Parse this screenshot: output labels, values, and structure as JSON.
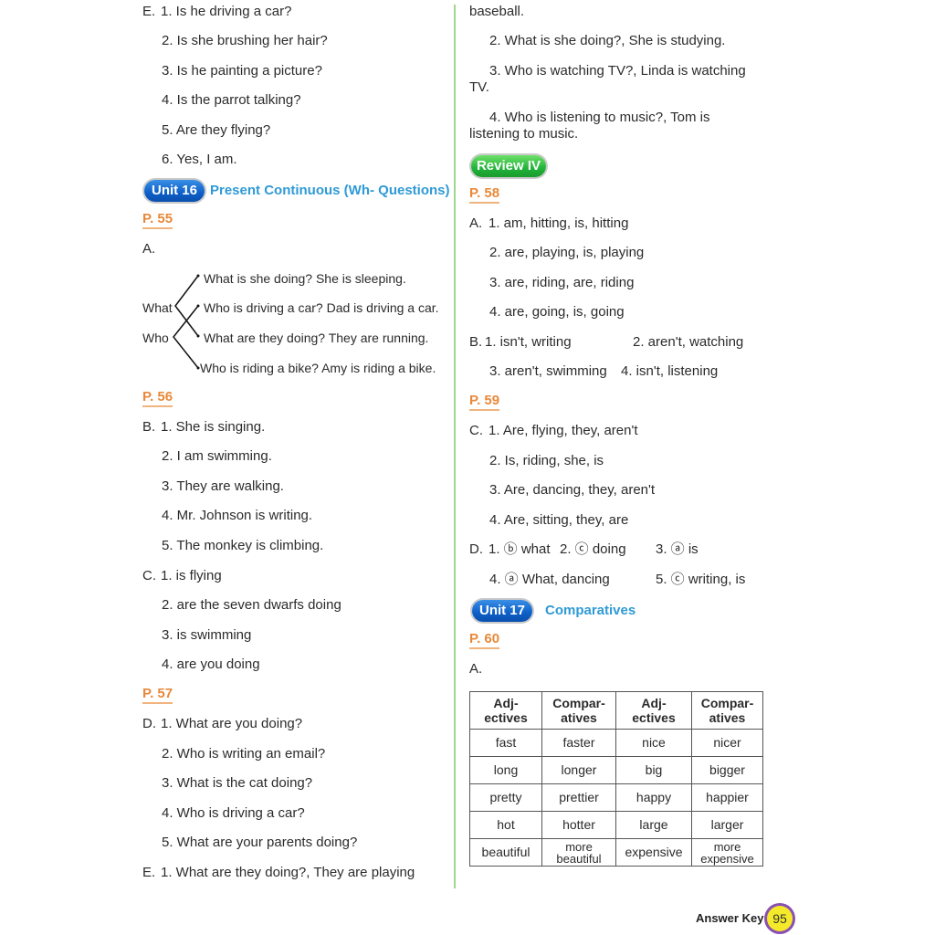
{
  "left": {
    "e_prev": {
      "label": "E.",
      "items": [
        "1. Is he driving a car?",
        "2. Is she brushing her hair?",
        "3. Is he painting a picture?",
        "4. Is the parrot talking?",
        "5. Are they flying?",
        "6. Yes, I am."
      ]
    },
    "unit16": {
      "badge": "Unit 16",
      "title": "Present Continuous (Wh- Questions)"
    },
    "p55": {
      "page": "P. 55",
      "label": "A.",
      "left_words": [
        "What",
        "Who"
      ],
      "right_sentences": [
        "What is she doing? She is sleeping.",
        "Who is driving a car? Dad is driving a car.",
        "What are they doing? They are running.",
        "Who is riding a bike? Amy is riding a bike."
      ]
    },
    "p56": {
      "page": "P. 56",
      "b": {
        "label": "B.",
        "items": [
          "1. She is singing.",
          "2. I am swimming.",
          "3. They are walking.",
          "4. Mr. Johnson is writing.",
          "5. The monkey is climbing."
        ]
      },
      "c": {
        "label": "C.",
        "items": [
          "1. is flying",
          "2. are the seven dwarfs doing",
          "3. is swimming",
          "4. are you doing"
        ]
      }
    },
    "p57": {
      "page": "P. 57",
      "d": {
        "label": "D.",
        "items": [
          "1. What are you doing?",
          "2. Who is writing an email?",
          "3. What is the cat doing?",
          "4. Who is driving a car?",
          "5. What are your parents doing?"
        ]
      },
      "e": {
        "label": "E.",
        "item1": "1. What are they doing?, They are playing"
      }
    }
  },
  "right": {
    "e_cont": {
      "item1_tail": "baseball.",
      "item2": "2. What is she doing?, She is studying.",
      "item3_a": "3. Who is watching TV?, Linda is watching",
      "item3_b": "TV.",
      "item4_a": "4. Who is listening to music?, Tom is",
      "item4_b": "listening to music."
    },
    "review": {
      "badge": "Review IV"
    },
    "p58": {
      "page": "P. 58",
      "a": {
        "label": "A.",
        "items": [
          "1. am, hitting, is, hitting",
          "2. are, playing, is, playing",
          "3. are, riding, are, riding",
          "4. are, going, is, going"
        ]
      },
      "b": {
        "label": "B.",
        "items": [
          "1. isn't, writing",
          "2. aren't, watching",
          "3. aren't, swimming",
          "4. isn't, listening"
        ]
      }
    },
    "p59": {
      "page": "P. 59",
      "c": {
        "label": "C.",
        "items": [
          "1. Are, flying, they, aren't",
          "2. Is, riding, she, is",
          "3. Are, dancing, they, aren't",
          "4. Are, sitting, they, are"
        ]
      },
      "d": {
        "label": "D.",
        "items": [
          "1. ⓑ what",
          "2. ⓒ doing",
          "3. ⓐ is",
          "4. ⓐ What, dancing",
          "5. ⓒ writing, is"
        ]
      }
    },
    "unit17": {
      "badge": "Unit 17",
      "title": "Comparatives"
    },
    "p60": {
      "page": "P. 60",
      "label": "A.",
      "table": {
        "headers": [
          [
            "Adj-",
            "ectives"
          ],
          [
            "Compar-",
            "atives"
          ],
          [
            "Adj-",
            "ectives"
          ],
          [
            "Compar-",
            "atives"
          ]
        ],
        "rows": [
          [
            "fast",
            "faster",
            "nice",
            "nicer"
          ],
          [
            "long",
            "longer",
            "big",
            "bigger"
          ],
          [
            "pretty",
            "prettier",
            "happy",
            "happier"
          ],
          [
            "hot",
            "hotter",
            "large",
            "larger"
          ],
          [
            "beautiful",
            "more beautiful",
            "expensive",
            "more expensive"
          ]
        ]
      }
    }
  },
  "footer": {
    "label": "Answer Key",
    "page_number": "95"
  }
}
